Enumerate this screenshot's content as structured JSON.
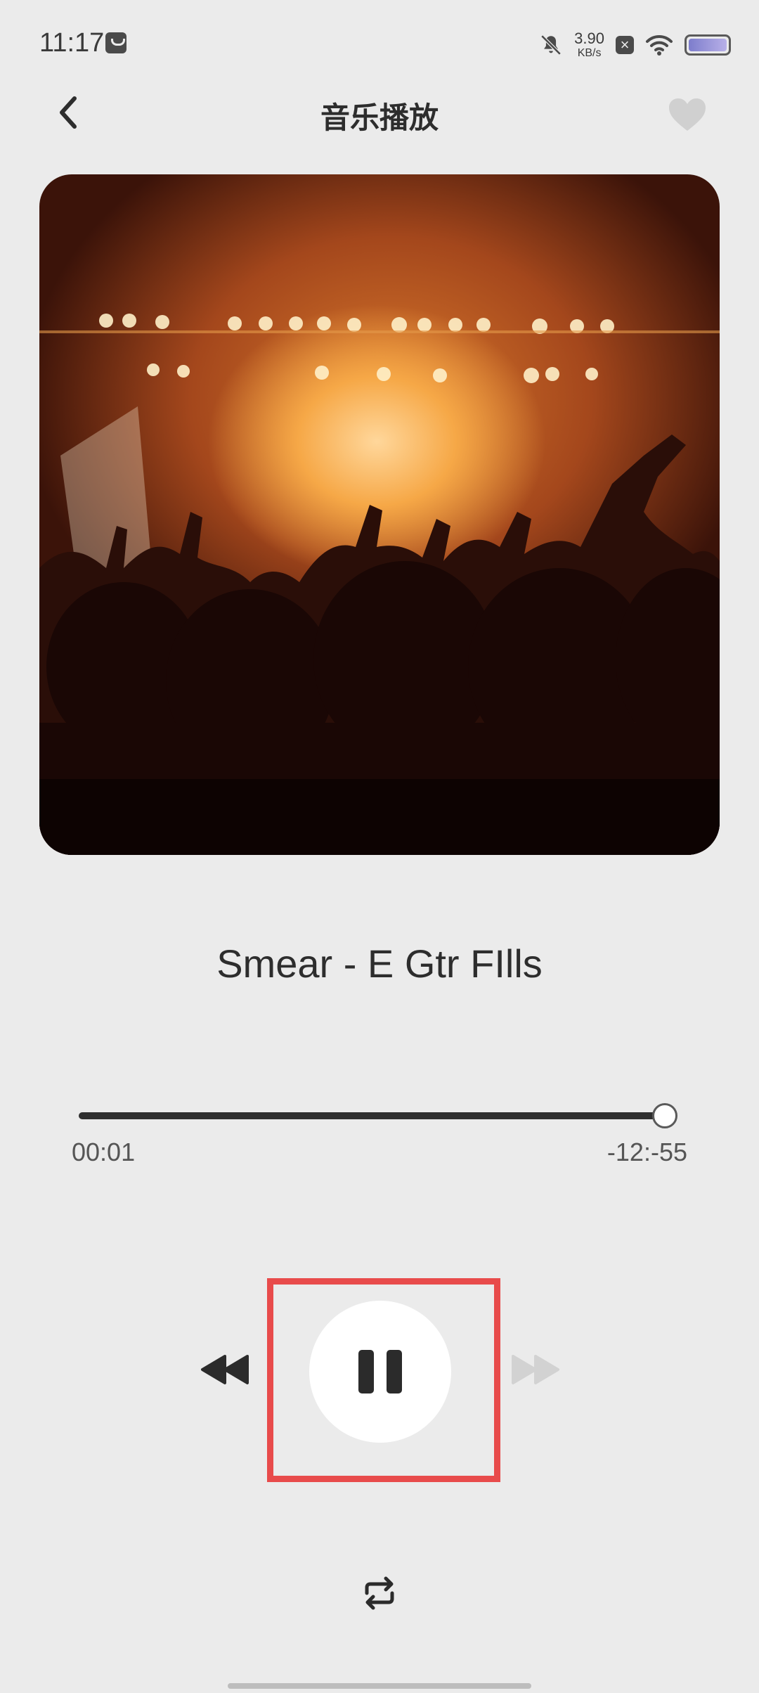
{
  "status_bar": {
    "time": "11:17",
    "net_speed_value": "3.90",
    "net_speed_unit": "KB/s",
    "icons": [
      "notification-app-icon",
      "mute-bell-icon",
      "close-square-icon",
      "wifi-icon",
      "battery-icon"
    ]
  },
  "header": {
    "title": "音乐播放",
    "back_icon": "chevron-left-icon",
    "favorite_icon": "heart-icon"
  },
  "player": {
    "track_title": "Smear - E Gtr FIlls",
    "elapsed": "00:01",
    "remaining": "-12:-55",
    "progress_fraction": 0.995,
    "state": "playing"
  },
  "controls": {
    "prev_icon": "rewind-icon",
    "play_pause_icon": "pause-icon",
    "next_icon": "fast-forward-icon",
    "repeat_icon": "repeat-icon",
    "next_enabled": false
  },
  "colors": {
    "background": "#ebebeb",
    "highlight": "#e84b4b",
    "progress": "#2f2f2f",
    "disabled": "#cfcfcf"
  }
}
